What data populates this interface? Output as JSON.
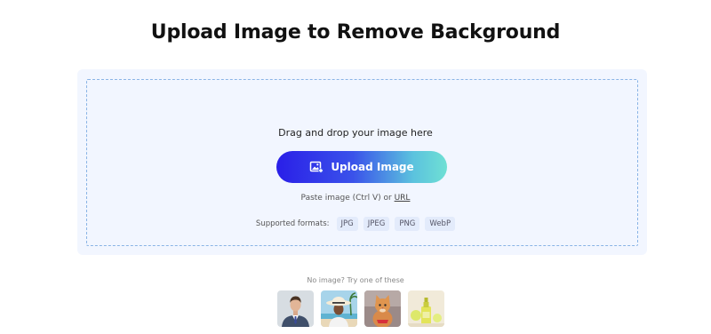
{
  "page": {
    "title": "Upload Image to Remove Background"
  },
  "upload": {
    "drag_text": "Drag and drop your image here",
    "button_label": "Upload Image",
    "button_icon": "image-add-icon",
    "paste_text": "Paste image (Ctrl V) or",
    "url_link": "URL",
    "formats_label": "Supported formats:",
    "formats": [
      "JPG",
      "JPEG",
      "PNG",
      "WebP"
    ]
  },
  "samples": {
    "caption": "No image? Try one of these",
    "items": [
      {
        "name": "man-in-suit-sample"
      },
      {
        "name": "woman-beach-hat-sample"
      },
      {
        "name": "cat-sample"
      },
      {
        "name": "bottle-product-sample"
      }
    ]
  },
  "colors": {
    "accent_start": "#2a1fe8",
    "accent_end": "#6fe0d4",
    "panel_bg": "#f2f6ff",
    "dash_border": "#8ab4e6"
  }
}
